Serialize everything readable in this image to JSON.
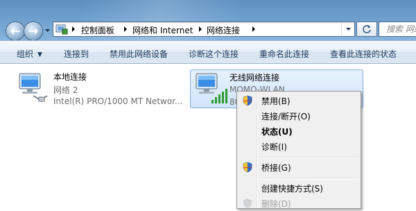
{
  "address": {
    "crumbs": [
      "控制面板",
      "网络和 Internet",
      "网络连接"
    ],
    "search_placeholder": "搜索 网络"
  },
  "toolbar": {
    "items": [
      "组织",
      "连接到",
      "禁用此网络设备",
      "诊断这个连接",
      "重命名此连接",
      "查看此连接的状态"
    ]
  },
  "connections": [
    {
      "name": "本地连接",
      "network": "网络  2",
      "adapter": "Intel(R) PRO/1000 MT Networ..."
    },
    {
      "name": "无线网络连接",
      "network": "MOMO-WLAN",
      "adapter": "80"
    }
  ],
  "context_menu": {
    "items": [
      {
        "label": "禁用(B)",
        "icon": "shield-icon",
        "bold": false,
        "disabled": false
      },
      {
        "label": "连接/断开(O)",
        "icon": null,
        "bold": false,
        "disabled": false
      },
      {
        "label": "状态(U)",
        "icon": null,
        "bold": true,
        "disabled": false
      },
      {
        "label": "诊断(I)",
        "icon": null,
        "bold": false,
        "disabled": false
      },
      {
        "label": "桥接(G)",
        "icon": "shield-icon",
        "bold": false,
        "disabled": false
      },
      {
        "label": "创建快捷方式(S)",
        "icon": null,
        "bold": false,
        "disabled": false
      },
      {
        "label": "删除(D)",
        "icon": "shield-icon",
        "bold": false,
        "disabled": true
      }
    ]
  },
  "colors": {
    "titlebar": "#6b9dcc",
    "selection": "#cfe4fa",
    "command_text": "#1e395b"
  }
}
